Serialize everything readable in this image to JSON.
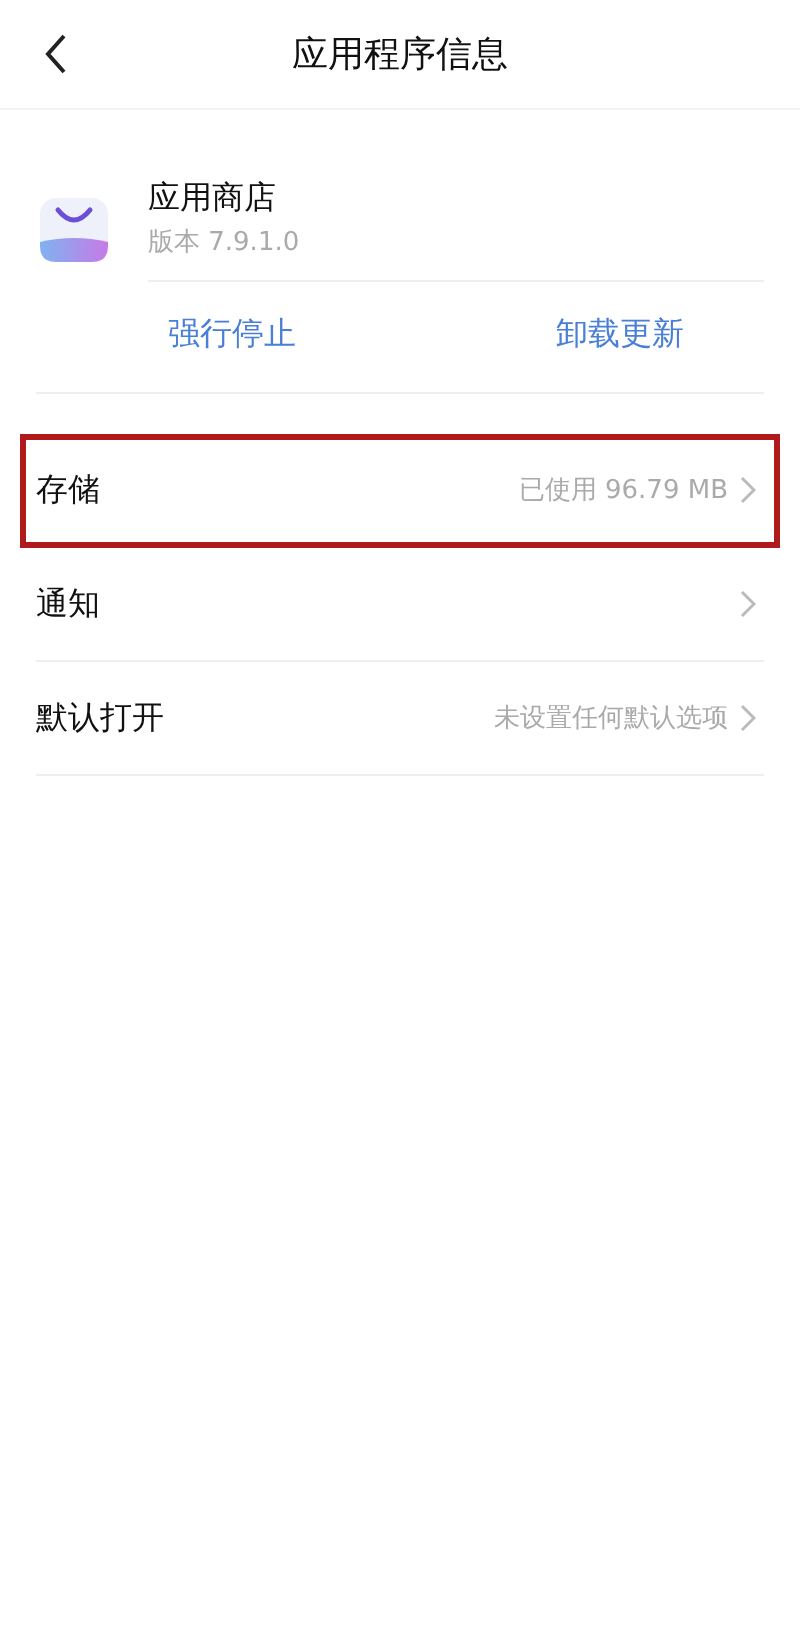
{
  "header": {
    "title": "应用程序信息"
  },
  "app": {
    "name": "应用商店",
    "version": "版本 7.9.1.0"
  },
  "actions": [
    {
      "label": "强行停止"
    },
    {
      "label": "卸载更新"
    }
  ],
  "settings": [
    {
      "label": "存储",
      "value": "已使用 96.79 MB",
      "highlighted": true
    },
    {
      "label": "通知",
      "highlighted": false
    },
    {
      "label": "默认打开",
      "value": "未设置任何默认选项",
      "highlighted": false
    }
  ]
}
